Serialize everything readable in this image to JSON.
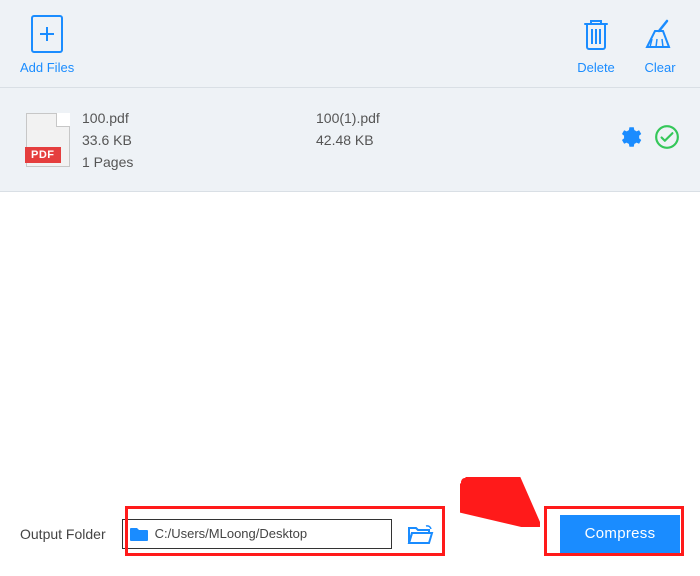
{
  "toolbar": {
    "add_files_label": "Add Files",
    "delete_label": "Delete",
    "clear_label": "Clear"
  },
  "files": [
    {
      "badge": "PDF",
      "name": "100.pdf",
      "size": "33.6 KB",
      "pages": "1 Pages",
      "output_name": "100(1).pdf",
      "output_size": "42.48 KB"
    }
  ],
  "footer": {
    "output_label": "Output Folder",
    "output_path": "C:/Users/MLoong/Desktop",
    "compress_label": "Compress"
  },
  "colors": {
    "primary": "#1a8cff",
    "danger": "#e53e3e",
    "success": "#34c759",
    "annotation": "#ff1a1a"
  }
}
